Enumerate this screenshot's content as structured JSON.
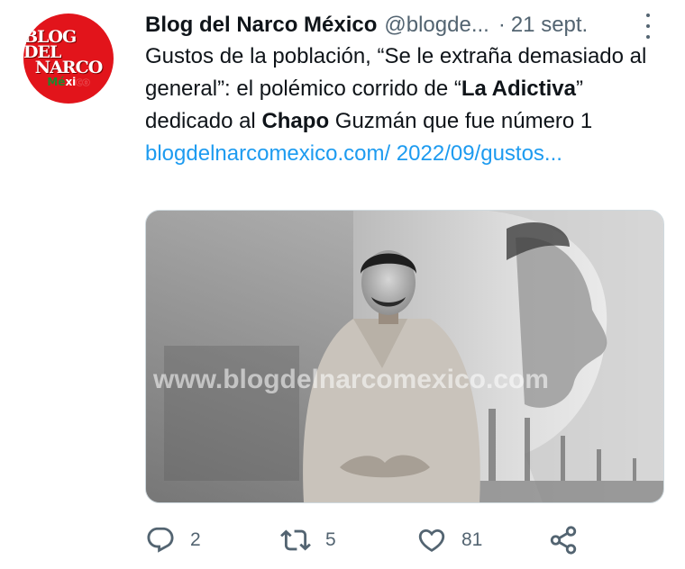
{
  "tweet": {
    "avatar": {
      "line1": "BLOG DEL",
      "line2": "NARCO",
      "m1": "Mé",
      "m2": "xi",
      "m3": "co"
    },
    "author_name": "Blog del Narco México",
    "handle": "@blogde...",
    "separator": "·",
    "date": "21 sept.",
    "text": {
      "p1": "Gustos de la población, “Se le extraña demasiado al general”: el polémico corrido de “",
      "bold1": "La Adictiva",
      "p2": "” dedicado al ",
      "bold2": "Chapo",
      "p3": " Guzmán que fue número 1 ",
      "link": "blogdelnarcomexico.com/ 2022/09/gustos..."
    },
    "media": {
      "watermark": "www.blogdelnarcomexico.com"
    },
    "actions": {
      "replies": "2",
      "retweets": "5",
      "likes": "81"
    }
  },
  "colors": {
    "text": "#0f1419",
    "secondary": "#536471",
    "link": "#1d9bf0",
    "avatar_bg": "#e2141b"
  },
  "icons": [
    "more-icon",
    "reply-icon",
    "retweet-icon",
    "like-icon",
    "share-icon"
  ]
}
